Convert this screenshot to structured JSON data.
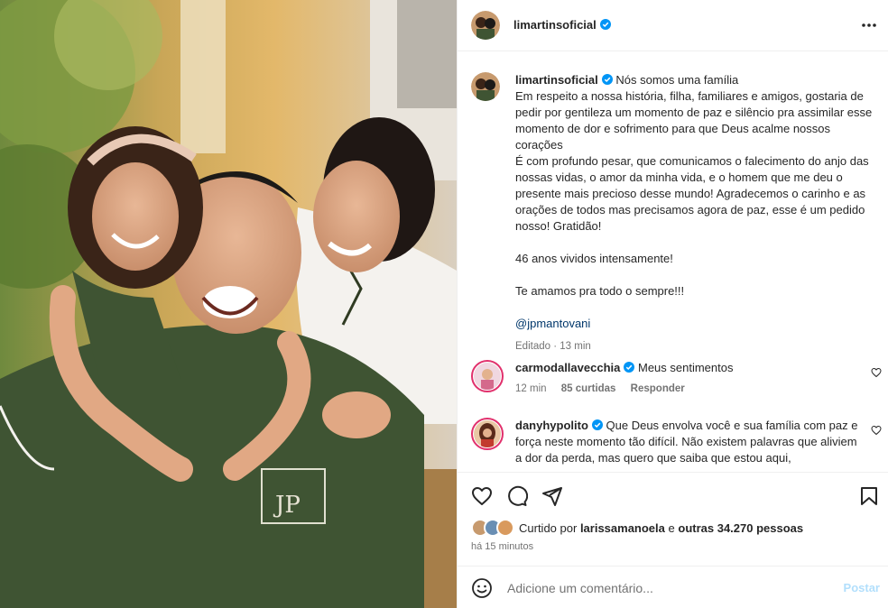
{
  "post": {
    "username": "limartinsoficial",
    "verified": true
  },
  "caption": {
    "username": "limartinsoficial",
    "first_line": "Nós somos uma família",
    "paragraphs": [
      "Em respeito a nossa história, filha, familiares e amigos, gostaria de pedir por gentileza um momento de paz e silêncio pra assimilar esse momento de dor e sofrimento para que Deus acalme nossos corações",
      "É com profundo pesar, que comunicamos o falecimento do anjo das nossas vidas, o amor da minha vida, e o homem que me deu o presente mais precioso desse mundo! Agradecemos o carinho e as orações de todos mas precisamos agora de paz, esse é um pedido nosso! Gratidão!",
      "46 anos vividos intensamente!",
      "Te amamos pra todo o sempre!!!"
    ],
    "mention": "@jpmantovani",
    "edited": "Editado",
    "time": "13 min"
  },
  "comments": [
    {
      "username": "carmodallavecchia",
      "text": "Meus sentimentos",
      "time": "12 min",
      "likes": "85 curtidas",
      "reply": "Responder"
    },
    {
      "username": "danyhypolito",
      "text": "Que Deus envolva você e sua família com paz e força neste momento tão difícil. Não existem palavras que aliviem a dor da perda, mas quero que saiba que estou aqui,"
    }
  ],
  "actions": {
    "icons": [
      "heart-icon",
      "comment-icon",
      "share-icon",
      "bookmark-icon"
    ]
  },
  "likes": {
    "prefix": "Curtido por",
    "user": "larissamanoela",
    "connector": "e",
    "others": "outras 34.270 pessoas"
  },
  "posted_ago": "há 15 minutos",
  "add_comment": {
    "placeholder": "Adicione um comentário...",
    "post_label": "Postar"
  },
  "colors": {
    "verified": "#0095f6",
    "link": "#00376b",
    "post_button": "#b2dffc",
    "story_ring": "#e1306c",
    "muted": "#737373"
  }
}
